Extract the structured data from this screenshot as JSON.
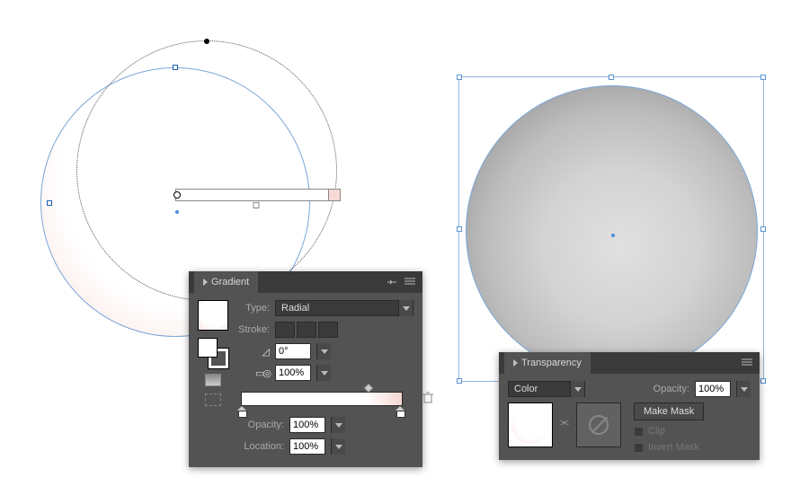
{
  "gradient_panel": {
    "title": "Gradient",
    "type_label": "Type:",
    "type_value": "Radial",
    "stroke_label": "Stroke:",
    "angle_value": "0°",
    "aspect_value": "100%",
    "opacity_label": "Opacity:",
    "opacity_value": "100%",
    "location_label": "Location:",
    "location_value": "100%"
  },
  "transparency_panel": {
    "title": "Transparency",
    "mode_value": "Color",
    "opacity_label": "Opacity:",
    "opacity_value": "100%",
    "make_mask": "Make Mask",
    "clip": "Clip",
    "invert_mask": "Invert Mask"
  }
}
